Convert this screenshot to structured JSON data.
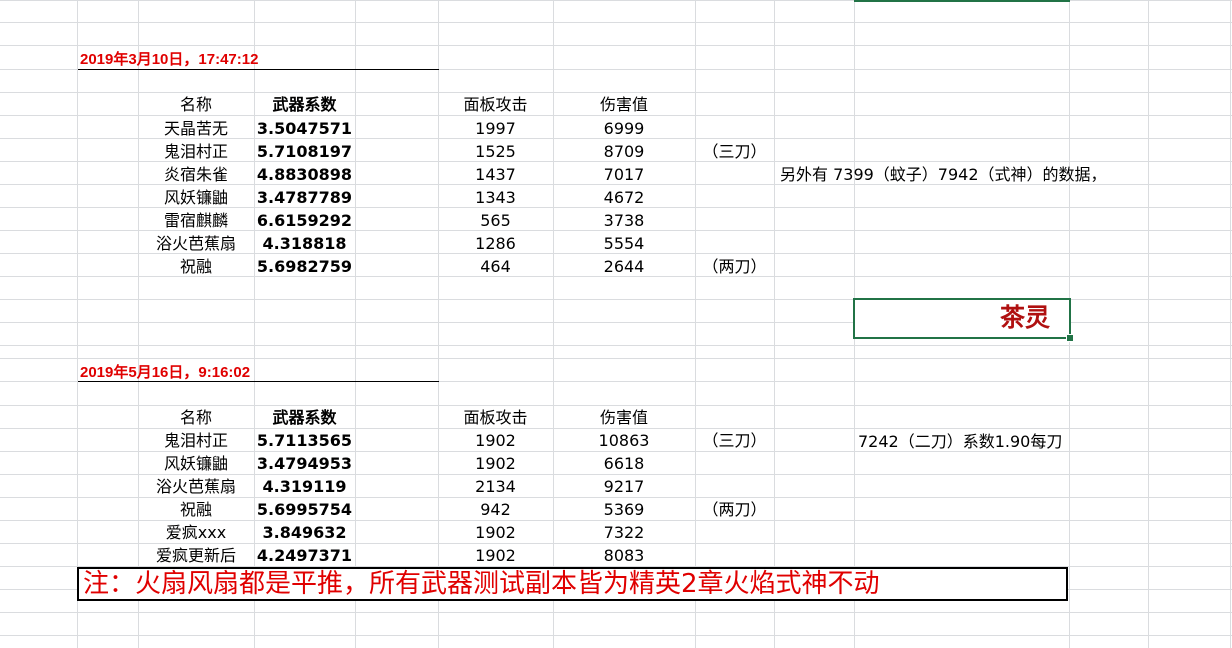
{
  "sections": [
    {
      "title": "2019年3月10日，17:47:12",
      "headers": [
        "名称",
        "武器系数",
        "面板攻击",
        "伤害值"
      ],
      "rows": [
        {
          "name": "天晶苦无",
          "coef": "3.5047571",
          "attack": "1997",
          "damage": "6999",
          "note": ""
        },
        {
          "name": "鬼泪村正",
          "coef": "5.7108197",
          "attack": "1525",
          "damage": "8709",
          "note": "（三刀）"
        },
        {
          "name": "炎宿朱雀",
          "coef": "4.8830898",
          "attack": "1437",
          "damage": "7017",
          "note": ""
        },
        {
          "name": "风妖镰鼬",
          "coef": "3.4787789",
          "attack": "1343",
          "damage": "4672",
          "note": ""
        },
        {
          "name": "雷宿麒麟",
          "coef": "6.6159292",
          "attack": "565",
          "damage": "3738",
          "note": ""
        },
        {
          "name": "浴火芭蕉扇",
          "coef": "4.318818",
          "attack": "1286",
          "damage": "5554",
          "note": ""
        },
        {
          "name": "祝融",
          "coef": "5.6982759",
          "attack": "464",
          "damage": "2644",
          "note": "（两刀）"
        }
      ],
      "side_note": "另外有 7399（蚊子）7942（式神）的数据，"
    },
    {
      "title": "2019年5月16日，9:16:02",
      "headers": [
        "名称",
        "武器系数",
        "面板攻击",
        "伤害值"
      ],
      "rows": [
        {
          "name": "鬼泪村正",
          "coef": "5.7113565",
          "attack": "1902",
          "damage": "10863",
          "note": "（三刀）"
        },
        {
          "name": "风妖镰鼬",
          "coef": "3.4794953",
          "attack": "1902",
          "damage": "6618",
          "note": ""
        },
        {
          "name": "浴火芭蕉扇",
          "coef": "4.319119",
          "attack": "2134",
          "damage": "9217",
          "note": ""
        },
        {
          "name": "祝融",
          "coef": "5.6995754",
          "attack": "942",
          "damage": "5369",
          "note": "（两刀）"
        },
        {
          "name": "爱疯xxx",
          "coef": "3.849632",
          "attack": "1902",
          "damage": "7322",
          "note": ""
        },
        {
          "name": "爱疯更新后",
          "coef": "4.2497371",
          "attack": "1902",
          "damage": "8083",
          "note": ""
        }
      ],
      "side_note": "7242（二刀）系数1.90每刀"
    }
  ],
  "selected_cell_text": "茶灵",
  "footer_note": "注：火扇风扇都是平推，所有武器测试副本皆为精英2章火焰式神不动",
  "colors": {
    "title_red": "#e00000",
    "note_red": "#e00000",
    "selection_green": "#217346",
    "gridline": "#dadcdf",
    "tea_text": "#b01010"
  }
}
